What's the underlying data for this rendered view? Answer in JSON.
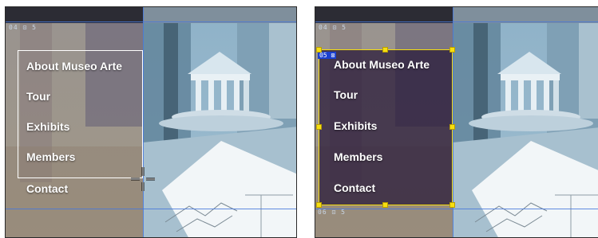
{
  "menu": {
    "items": [
      {
        "label": "About Museo Arte"
      },
      {
        "label": "Tour"
      },
      {
        "label": "Exhibits"
      },
      {
        "label": "Members"
      },
      {
        "label": "Contact"
      }
    ]
  },
  "tags": {
    "outer": "04 ⊡ 5",
    "selected": "05 ⊠",
    "lower": "06 ⊡ 5"
  },
  "icons": {
    "crosshair": "crosshair-cursor-icon"
  },
  "colors": {
    "selection": "#f7df10",
    "guides": "#4678dc",
    "div_outline": "#ffffff"
  }
}
